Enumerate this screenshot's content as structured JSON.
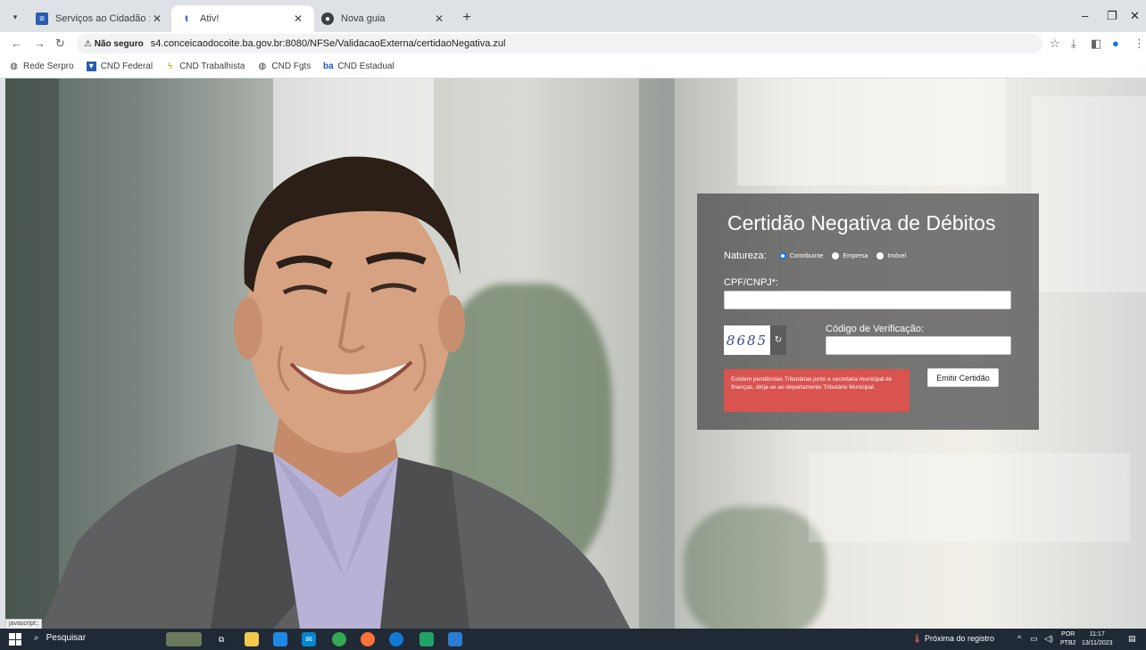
{
  "browser": {
    "tabs": [
      {
        "title": "Serviços ao Cidadão : Prefeitura",
        "favicon": "doc-icon",
        "active": false
      },
      {
        "title": "Ativ!",
        "favicon": "t-icon",
        "active": true
      },
      {
        "title": "Nova guia",
        "favicon": "globe-icon",
        "active": false
      }
    ],
    "address": {
      "security": "Não seguro",
      "url": "s4.conceicaodocoite.ba.gov.br:8080/NFSe/ValidacaoExterna/certidaoNegativa.zul"
    },
    "bookmarks": [
      {
        "label": "Rede Serpro",
        "icon": "globe-icon"
      },
      {
        "label": "CND Federal",
        "icon": "shield-icon"
      },
      {
        "label": "CND Trabalhista",
        "icon": "scales-icon"
      },
      {
        "label": "CND Fgts",
        "icon": "globe-icon"
      },
      {
        "label": "CND Estadual",
        "icon": "bahia-icon"
      }
    ],
    "status_text": "javascript:;"
  },
  "form": {
    "title": "Certidão Negativa de Débitos",
    "natureza_label": "Natureza:",
    "natureza_options": [
      {
        "label": "Contribuinte",
        "selected": true
      },
      {
        "label": "Empresa",
        "selected": false
      },
      {
        "label": "Imóvel",
        "selected": false
      }
    ],
    "cpf_label": "CPF/CNPJ*:",
    "cpf_value": "",
    "captcha_text": "8685",
    "code_label": "Código de Verificação:",
    "code_value": "",
    "error_message": "Existem pendências Tributárias junto a secretaria municipal de finanças, dirija-se ao departamento Tributário Municipal.",
    "emit_button": "Emitir Certidão"
  },
  "taskbar": {
    "search_placeholder": "Pesquisar",
    "weather_text": "Próxima do registro",
    "language": "POR",
    "keyboard": "PTB2",
    "time": "11:17",
    "date": "13/11/2023"
  },
  "colors": {
    "error_bg": "#d9534f",
    "panel_bg": "rgba(70,70,70,0.72)",
    "taskbar_bg": "#1f2a36"
  }
}
